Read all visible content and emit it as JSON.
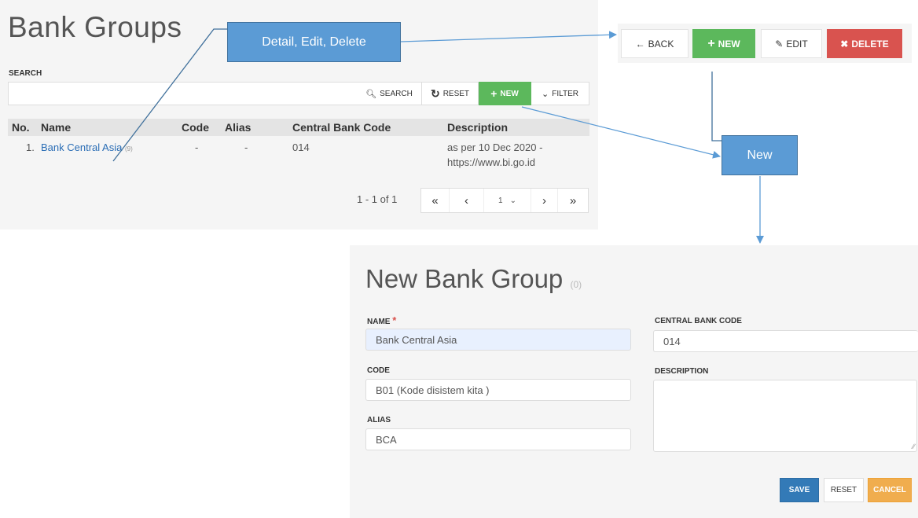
{
  "list": {
    "title": "Bank Groups",
    "search_label": "SEARCH",
    "search_value": "",
    "toolbar": {
      "search": "SEARCH",
      "reset": "RESET",
      "new": "NEW",
      "filter": "FILTER"
    },
    "columns": {
      "no": "No.",
      "name": "Name",
      "code": "Code",
      "alias": "Alias",
      "central": "Central Bank Code",
      "description": "Description"
    },
    "rows": [
      {
        "no": "1.",
        "name": "Bank Central Asia",
        "count": "(9)",
        "code": "-",
        "alias": "-",
        "central": "014",
        "description_line1": "as per 10 Dec 2020 -",
        "description_line2": "https://www.bi.go.id"
      }
    ],
    "pager": {
      "info": "1 - 1 of 1",
      "first": "«",
      "prev": "‹",
      "page": "1",
      "next": "›",
      "last": "»"
    }
  },
  "detail_actions": {
    "back": "BACK",
    "new": "NEW",
    "edit": "EDIT",
    "delete": "DELETE"
  },
  "callouts": {
    "detail": "Detail, Edit, Delete",
    "new": "New"
  },
  "form": {
    "title": "New Bank Group",
    "count": "(0)",
    "name_label": "NAME",
    "required_mark": "*",
    "name_value": "Bank Central Asia",
    "code_label": "CODE",
    "code_value": "B01 (Kode disistem kita )",
    "alias_label": "ALIAS",
    "alias_value": "BCA",
    "central_label": "CENTRAL BANK CODE",
    "central_value": "014",
    "description_label": "DESCRIPTION",
    "description_value": "",
    "save": "SAVE",
    "reset": "RESET",
    "cancel": "CANCEL"
  },
  "colors": {
    "green": "#5cb85c",
    "red": "#d9534f",
    "blue": "#337ab7",
    "orange": "#f0ad4e",
    "link": "#2a6db5",
    "callout": "#5b9bd5"
  }
}
